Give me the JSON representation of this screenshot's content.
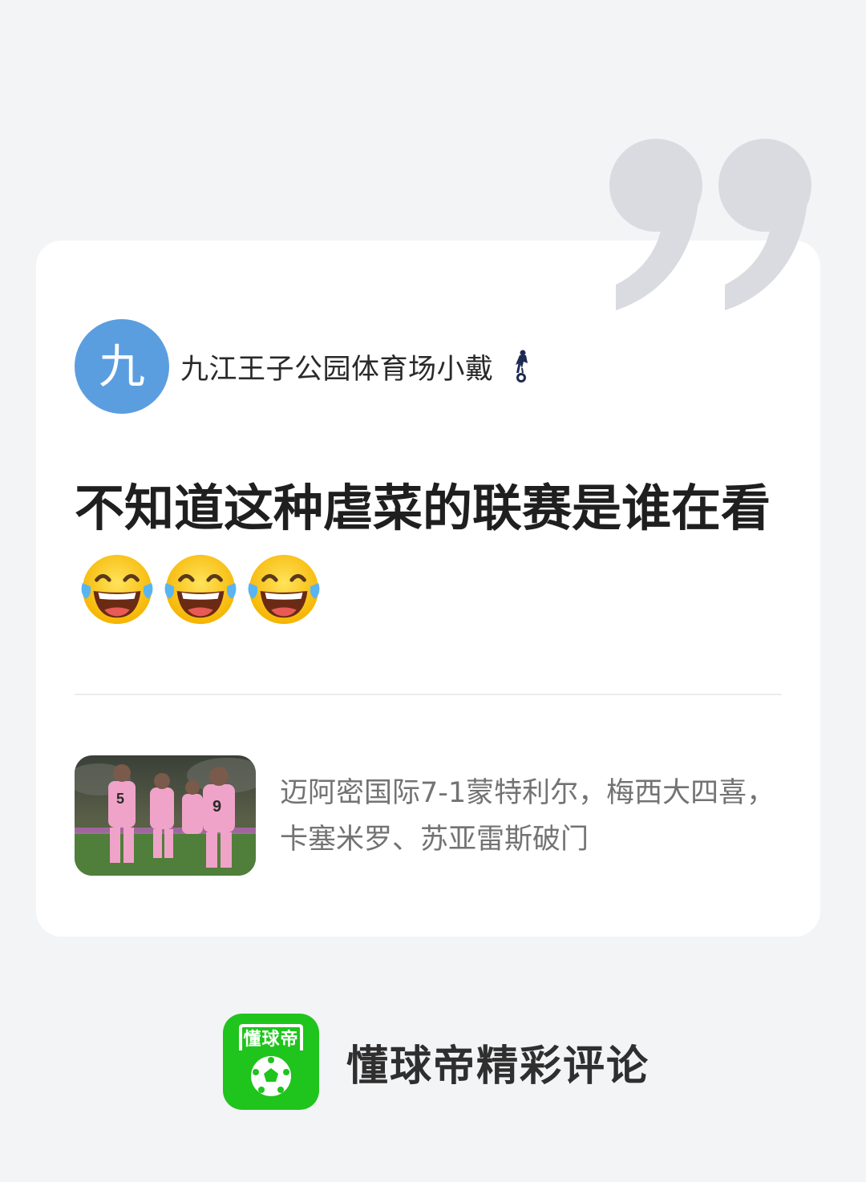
{
  "author": {
    "avatar_char": "九",
    "name": "九江王子公园体育场小戴",
    "badge_icon": "tottenham-club-icon"
  },
  "comment": {
    "text": "不知道这种虐菜的联赛是谁在看",
    "emojis": [
      "face-with-tears-of-joy",
      "face-with-tears-of-joy",
      "face-with-tears-of-joy"
    ]
  },
  "news": {
    "thumbnail": "inter-miami-players-celebrating-photo",
    "title": "迈阿密国际7-1蒙特利尔，梅西大四喜，卡塞米罗、苏亚雷斯破门"
  },
  "footer": {
    "logo_text": "懂球帝",
    "text": "懂球帝精彩评论"
  },
  "colors": {
    "background": "#f3f4f6",
    "card": "#ffffff",
    "avatar": "#5b9ee0",
    "brand_green": "#1fc41c",
    "quote_mark": "#d9dbe0"
  }
}
